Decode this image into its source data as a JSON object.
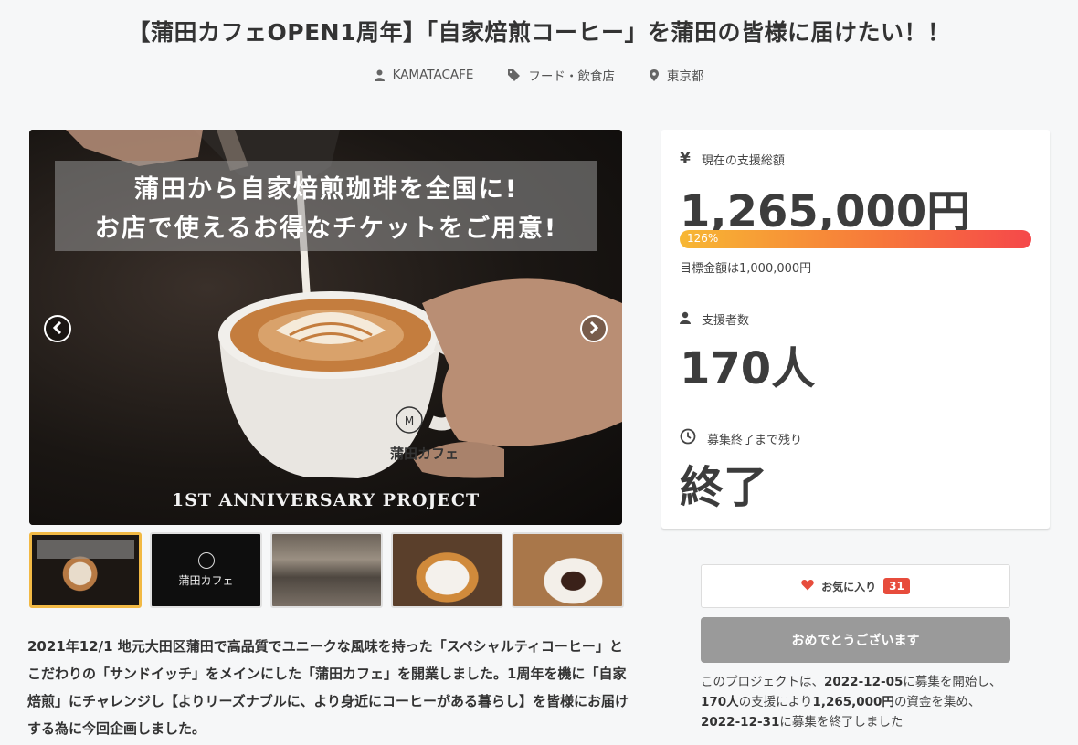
{
  "project": {
    "title": "【蒲田カフェOPEN1周年】「自家焙煎コーヒー」を蒲田の皆様に届けたい！！",
    "owner": "KAMATACAFE",
    "category": "フード・飲食店",
    "location": "東京都"
  },
  "hero": {
    "banner_line1": "蒲田から自家焙煎珈琲を全国に!",
    "banner_line2": "お店で使えるお得なチケットをご用意!",
    "caption": "1ST ANNIVERSARY PROJECT",
    "cup_logo": "蒲田カフェ"
  },
  "thumbnails": [
    {
      "name": "thumb-1",
      "active": true
    },
    {
      "name": "thumb-2",
      "active": false,
      "text": "蒲田カフェ"
    },
    {
      "name": "thumb-3",
      "active": false
    },
    {
      "name": "thumb-4",
      "active": false
    },
    {
      "name": "thumb-5",
      "active": false
    }
  ],
  "description": "2021年12/1 地元大田区蒲田で高品質でユニークな風味を持った「スペシャルティコーヒー」とこだわりの「サンドイッチ」をメインにした「蒲田カフェ」を開業しました。1周年を機に「自家焙煎」にチャレンジし【よりリーズナブルに、より身近にコーヒーがある暮らし】を皆様にお届けする為に今回企画しました。",
  "stats": {
    "amount_label": "現在の支援総額",
    "amount_value": "1,265,000円",
    "progress_text": "126%",
    "progress_percent": 126,
    "goal_text": "目標金額は1,000,000円",
    "supporters_label": "支援者数",
    "supporters_value": "170人",
    "remaining_label": "募集終了まで残り",
    "remaining_value": "終了"
  },
  "favorite": {
    "label": "お気に入り",
    "count": "31"
  },
  "done_button": "おめでとうございます",
  "summary": {
    "p1": "このプロジェクトは、",
    "start": "2022-12-05",
    "p2": "に募集を開始し、",
    "supporters": "170人",
    "p3": "の支援により",
    "amount": "1,265,000円",
    "p4": "の資金を集め、",
    "end": "2022-12-31",
    "p5": "に募集を終了しました"
  },
  "colors": {
    "accent_gradient_start": "#f7b733",
    "accent_gradient_end": "#f5484a",
    "favorite_red": "#e74c3c",
    "active_thumb_border": "#f2b944",
    "done_button_gray": "#9a9a9a"
  },
  "icons": [
    "user-icon",
    "tag-icon",
    "map-pin-icon",
    "yen-icon",
    "supporters-icon",
    "clock-icon",
    "heart-icon",
    "chevron-left-icon",
    "chevron-right-icon"
  ]
}
